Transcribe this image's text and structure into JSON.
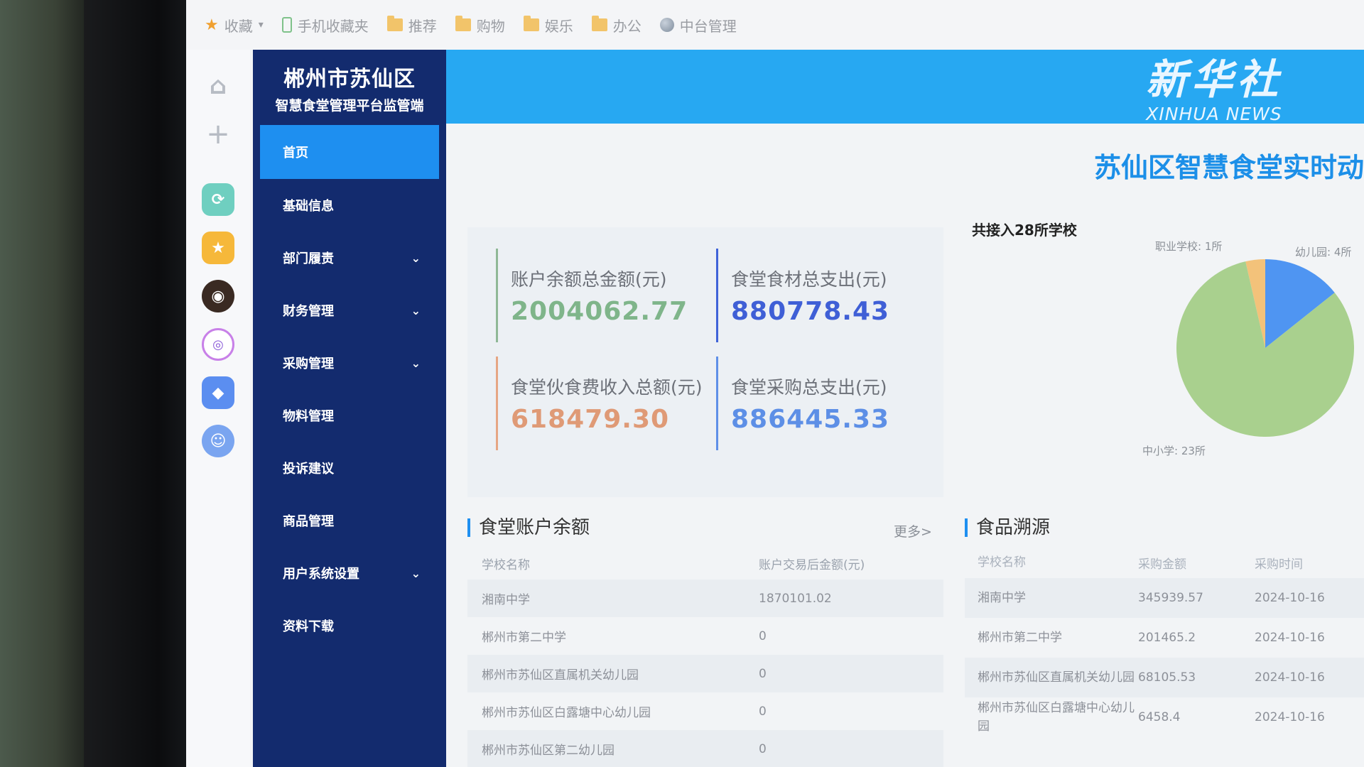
{
  "bookmarks": {
    "items": [
      "收藏",
      "手机收藏夹",
      "推荐",
      "购物",
      "娱乐",
      "办公",
      "中台管理"
    ]
  },
  "sidebar": {
    "title": "郴州市苏仙区",
    "subtitle": "智慧食堂管理平台监管端",
    "items": [
      {
        "label": "首页",
        "active": true
      },
      {
        "label": "基础信息"
      },
      {
        "label": "部门履责",
        "expandable": true
      },
      {
        "label": "财务管理",
        "expandable": true
      },
      {
        "label": "采购管理",
        "expandable": true
      },
      {
        "label": "物料管理"
      },
      {
        "label": "投诉建议"
      },
      {
        "label": "商品管理"
      },
      {
        "label": "用户系统设置",
        "expandable": true
      },
      {
        "label": "资料下载"
      }
    ]
  },
  "watermark": {
    "cn": "新华社",
    "en": "XINHUA NEWS"
  },
  "page_title": "苏仙区智慧食堂实时动",
  "stats": [
    {
      "label": "账户余额总金额(元)",
      "value": "2004062.77",
      "color": "#7fb58a"
    },
    {
      "label": "食堂食材总支出(元)",
      "value": "880778.43",
      "color": "#3f5fd6"
    },
    {
      "label": "食堂伙食费收入总额(元)",
      "value": "618479.30",
      "color": "#df9a76"
    },
    {
      "label": "食堂采购总支出(元)",
      "value": "886445.33",
      "color": "#5d8fe6"
    }
  ],
  "pie": {
    "title": "共接入28所学校",
    "slices": [
      {
        "label": "职业学校: 1所",
        "value": 1,
        "color": "#f3c27a"
      },
      {
        "label": "幼儿园: 4所",
        "value": 4,
        "color": "#4f95f2"
      },
      {
        "label": "中小学: 23所",
        "value": 23,
        "color": "#a9d08e"
      }
    ]
  },
  "balance": {
    "title": "食堂账户余额",
    "more": "更多>",
    "columns": [
      "学校名称",
      "账户交易后金额(元)"
    ],
    "rows": [
      [
        "湘南中学",
        "1870101.02"
      ],
      [
        "郴州市第二中学",
        "0"
      ],
      [
        "郴州市苏仙区直属机关幼儿园",
        "0"
      ],
      [
        "郴州市苏仙区白露塘中心幼儿园",
        "0"
      ],
      [
        "郴州市苏仙区第二幼儿园",
        "0"
      ]
    ]
  },
  "trace": {
    "title": "食品溯源",
    "columns": [
      "学校名称",
      "采购金额",
      "采购时间"
    ],
    "rows": [
      [
        "湘南中学",
        "345939.57",
        "2024-10-16"
      ],
      [
        "郴州市第二中学",
        "201465.2",
        "2024-10-16"
      ],
      [
        "郴州市苏仙区直属机关幼儿园",
        "68105.53",
        "2024-10-16"
      ],
      [
        "郴州市苏仙区白露塘中心幼儿园",
        "6458.4",
        "2024-10-16"
      ]
    ]
  }
}
